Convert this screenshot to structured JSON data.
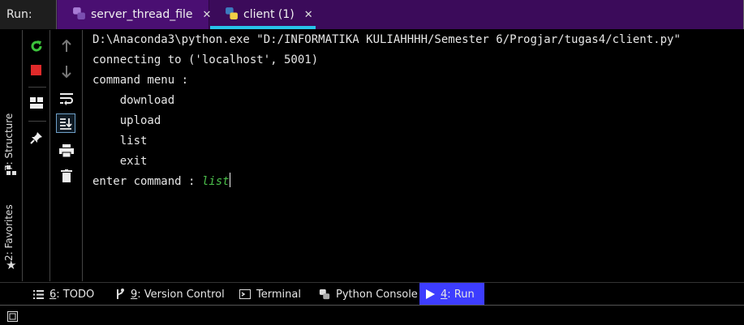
{
  "run_header": {
    "label": "Run:",
    "tabs": [
      {
        "label": "server_thread_file",
        "close": "✕"
      },
      {
        "label": "client (1)",
        "close": "✕"
      }
    ]
  },
  "left_strip": {
    "structure": "7: Structure",
    "favorites": "2: Favorites"
  },
  "console": {
    "lines": [
      "D:\\Anaconda3\\python.exe \"D:/INFORMATIKA KULIAHHHH/Semester 6/Progjar/tugas4/client.py\"",
      "connecting to ('localhost', 5001)",
      "command menu :",
      "    download",
      "    upload",
      "    list",
      "    exit"
    ],
    "prompt": "enter command : ",
    "input": "list"
  },
  "bottom_tabs": {
    "todo": {
      "key": "6",
      "rest": ": TODO"
    },
    "vcs": {
      "key": "9",
      "rest": ": Version Control"
    },
    "terminal": "Terminal",
    "python_console": "Python Console",
    "run": {
      "key": "4",
      "rest": ": Run"
    }
  },
  "colors": {
    "run_header_bg": "#3b0b5a",
    "active_tab_underline": "#27c4ea",
    "rerun_green": "#3cc43c",
    "stop_red": "#e02a2a",
    "input_green": "#4bc04b",
    "active_bottom_tab": "#3d3dff"
  }
}
